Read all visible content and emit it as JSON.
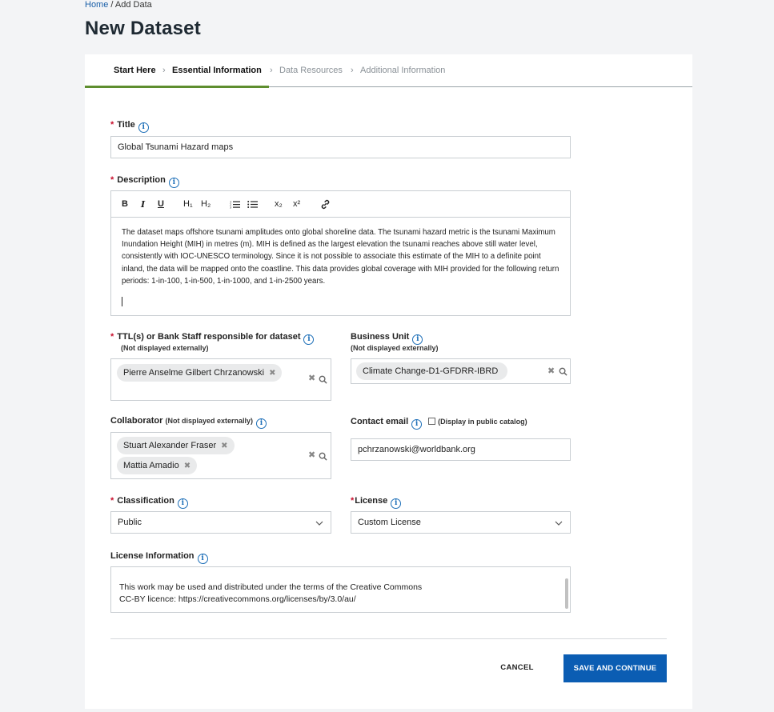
{
  "breadcrumb": {
    "home": "Home",
    "separator": "/",
    "current": "Add Data"
  },
  "page_title": "New Dataset",
  "steps": [
    {
      "label": "Start Here",
      "state": "done"
    },
    {
      "label": "Essential Information",
      "state": "current"
    },
    {
      "label": "Data Resources",
      "state": "upcoming"
    },
    {
      "label": "Additional Information",
      "state": "upcoming"
    }
  ],
  "step_separator": "›",
  "accent_colors": {
    "primary_button": "#0b5db3",
    "step_active": "#5e8e2f",
    "required": "#c8102e",
    "info_icon": "#1d6fb8"
  },
  "form": {
    "required_mark": "*",
    "info_glyph": "i",
    "title": {
      "label": "Title",
      "value": "Global Tsunami Hazard maps"
    },
    "description": {
      "label": "Description",
      "toolbar": [
        "B",
        "I",
        "U",
        "H1",
        "H2",
        "ordered-list",
        "bullet-list",
        "subscript",
        "superscript",
        "link"
      ],
      "toolbar_text": {
        "bold": "B",
        "italic": "I",
        "underline": "U",
        "h1": "H₁",
        "h2": "H₂",
        "subscript": "x₂",
        "superscript": "x²"
      },
      "text": "The dataset maps offshore tsunami amplitudes onto global shoreline data. The tsunami hazard metric is the tsunami Maximum Inundation Height (MIH) in metres (m). MIH is defined as the largest elevation the tsunami reaches above still water level, consistently with IOC-UNESCO terminology. Since it is not possible to associate this estimate of the MIH to a definite point inland, the data will be mapped onto the coastline. This data provides global coverage with MIH provided for the following return periods: 1-in-100, 1-in-500, 1-in-1000, and 1-in-2500 years."
    },
    "ttl": {
      "label": "TTL(s) or Bank Staff responsible for dataset",
      "sublabel": "(Not displayed externally)",
      "values": [
        "Pierre Anselme Gilbert Chrzanowski"
      ]
    },
    "business_unit": {
      "label": "Business Unit",
      "sublabel": "(Not displayed externally)",
      "values": [
        "Climate Change-D1-GFDRR-IBRD"
      ]
    },
    "collaborator": {
      "label": "Collaborator",
      "sublabel": "(Not displayed externally)",
      "values": [
        "Stuart Alexander Fraser",
        "Mattia Amadio"
      ]
    },
    "contact_email": {
      "label": "Contact email",
      "checkbox_label": "(Display in public catalog)",
      "value": "pchrzanowski@worldbank.org"
    },
    "classification": {
      "label": "Classification",
      "value": "Public"
    },
    "license": {
      "label": "License",
      "value": "Custom License"
    },
    "license_information": {
      "label": "License Information",
      "line1": "This work may be used and distributed under the terms of the Creative Commons",
      "line2": "CC-BY licence: https://creativecommons.org/licenses/by/3.0/au/"
    },
    "chip_remove_glyph": "✖",
    "clear_glyph": "✖"
  },
  "actions": {
    "cancel": "CANCEL",
    "save": "SAVE AND CONTINUE"
  }
}
